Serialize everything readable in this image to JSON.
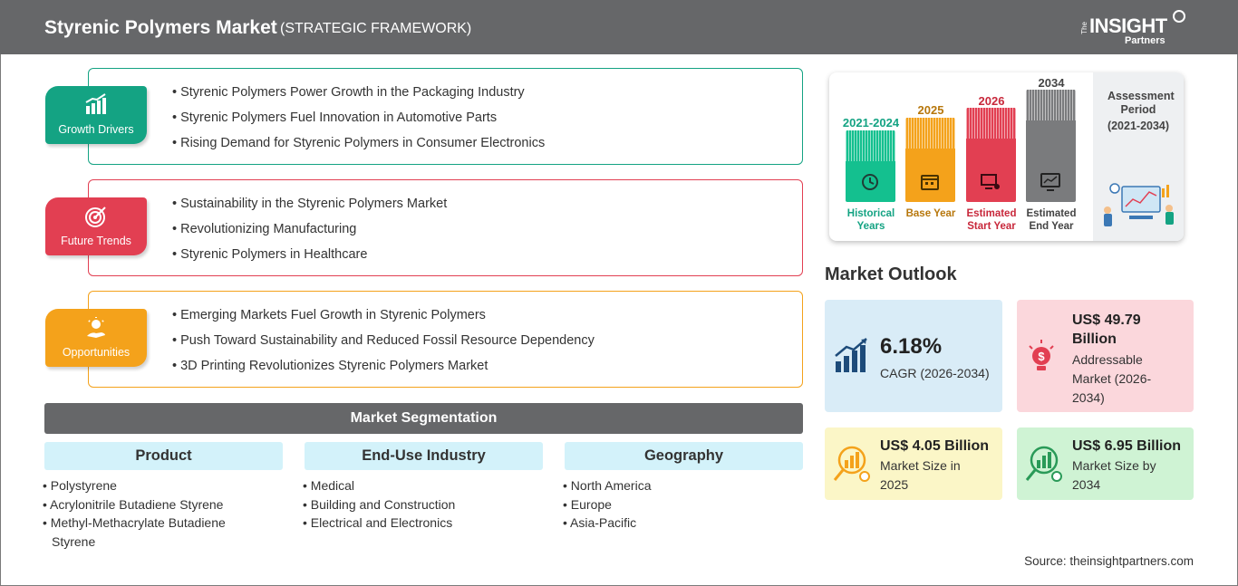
{
  "header": {
    "title": "Styrenic Polymers Market",
    "subtitle": "(STRATEGIC FRAMEWORK)",
    "logo": {
      "the": "The",
      "insight": "INSIGHT",
      "partners": "Partners"
    }
  },
  "drivers": [
    {
      "label": "Growth Drivers",
      "color": "#14a383",
      "icon": "growth-chart-icon",
      "items": [
        "Styrenic Polymers Power Growth in the Packaging Industry",
        "Styrenic Polymers Fuel Innovation in Automotive Parts",
        "Rising Demand for Styrenic Polymers in Consumer Electronics"
      ]
    },
    {
      "label": "Future Trends",
      "color": "#e23f52",
      "icon": "target-icon",
      "items": [
        "Sustainability in the Styrenic Polymers Market",
        "Revolutionizing Manufacturing",
        "Styrenic Polymers in Healthcare"
      ]
    },
    {
      "label": "Opportunities",
      "color": "#f4a21b",
      "icon": "lightbulb-hand-icon",
      "items": [
        "Emerging Markets Fuel Growth in Styrenic Polymers",
        "Push Toward Sustainability and Reduced Fossil Resource Dependency",
        "3D Printing Revolutionizes Styrenic Polymers Market"
      ]
    }
  ],
  "segmentation": {
    "title": "Market Segmentation",
    "columns": [
      {
        "head": "Product",
        "items": [
          "Polystyrene",
          "Acrylonitrile Butadiene Styrene",
          "Methyl-Methacrylate Butadiene Styrene"
        ]
      },
      {
        "head": "End-Use Industry",
        "items": [
          "Medical",
          "Building and Construction",
          "Electrical and Electronics"
        ]
      },
      {
        "head": "Geography",
        "items": [
          "North America",
          "Europe",
          "Asia-Pacific"
        ]
      }
    ]
  },
  "timeline": {
    "bars": [
      {
        "year": "2021-2024",
        "label": "Historical Years",
        "color": "#14c08f",
        "text_color": "#14a383",
        "icon": "history-icon"
      },
      {
        "year": "2025",
        "label": "Base Year",
        "color": "#f4a21b",
        "text_color": "#b7770c",
        "icon": "calendar-icon"
      },
      {
        "year": "2026",
        "label": "Estimated Start Year",
        "color": "#e23f52",
        "text_color": "#c8283b",
        "icon": "presentation-icon"
      },
      {
        "year": "2034",
        "label": "Estimated End Year",
        "color": "#7a7b7d",
        "text_color": "#444444",
        "icon": "monitor-chart-icon"
      }
    ],
    "assessment": {
      "label": "Assessment Period",
      "period": "(2021-2034)"
    }
  },
  "outlook": {
    "title": "Market Outlook",
    "cagr": {
      "value": "6.18%",
      "label": "CAGR (2026-2034)",
      "bg": "#d9ecf7"
    },
    "addressable": {
      "value": "US$ 49.79 Billion",
      "label": "Addressable Market (2026-2034)",
      "bg": "#fbd7dc"
    },
    "size_2025": {
      "value": "US$ 4.05 Billion",
      "label": "Market Size in 2025",
      "bg": "#fbf6c7"
    },
    "size_2034": {
      "value": "US$ 6.95 Billion",
      "label": "Market Size by 2034",
      "bg": "#cff3d4"
    }
  },
  "source": "Source: theinsightpartners.com"
}
